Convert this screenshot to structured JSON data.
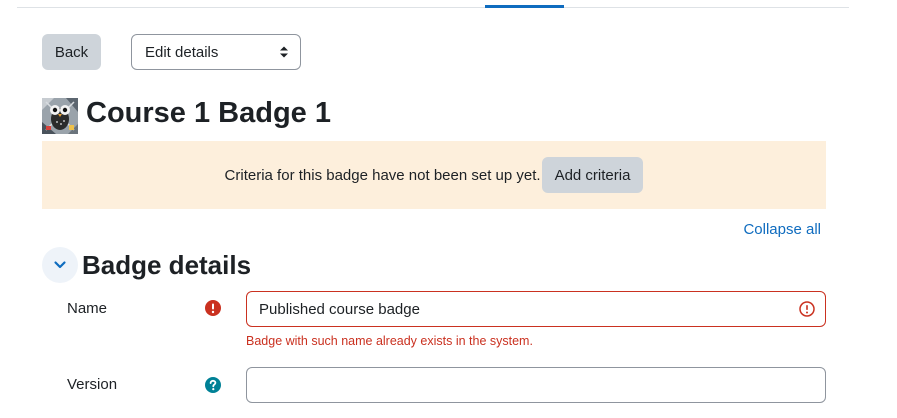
{
  "toolbar": {
    "back_label": "Back",
    "action_select": {
      "selected": "Edit details",
      "options": [
        "Edit details"
      ]
    }
  },
  "page": {
    "title": "Course 1 Badge 1",
    "badge_image_icon": "badge-owl-image"
  },
  "alert": {
    "message": "Criteria for this badge have not been set up yet.",
    "button_label": "Add criteria",
    "background_color": "#fdefdc"
  },
  "collapse_all_label": "Collapse all",
  "section": {
    "title": "Badge details",
    "expanded": true,
    "toggle_icon": "chevron-down-icon"
  },
  "form": {
    "name": {
      "label": "Name",
      "value": "Published course badge",
      "required_icon": "exclamation-circle-icon",
      "error": "Badge with such name already exists in the system."
    },
    "version": {
      "label": "Version",
      "value": "",
      "help_icon": "question-circle-icon"
    }
  },
  "colors": {
    "primary": "#0f6cbf",
    "danger": "#ca3120",
    "info": "#008196",
    "secondary_button": "#ced4da"
  }
}
